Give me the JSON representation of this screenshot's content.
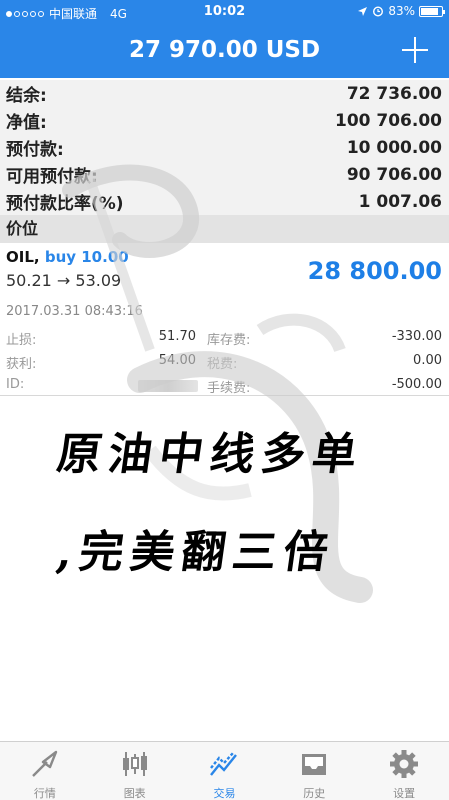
{
  "status_bar": {
    "carrier": "中国联通",
    "network": "4G",
    "time": "10:02",
    "battery": "83%",
    "battery_level": 0.83,
    "signal_bars": 1
  },
  "nav": {
    "title": "27 970.00 USD",
    "add_icon": "plus-icon"
  },
  "account": [
    {
      "label": "结余:",
      "value": "72 736.00"
    },
    {
      "label": "净值:",
      "value": "100 706.00"
    },
    {
      "label": "预付款:",
      "value": "10 000.00"
    },
    {
      "label": "可用预付款:",
      "value": "90 706.00"
    },
    {
      "label": "预付款比率(%)",
      "value": "1 007.06"
    }
  ],
  "positions_header": "价位",
  "position": {
    "symbol": "OIL,",
    "side": "buy 10.00",
    "prices": "50.21 → 53.09",
    "profit": "28 800.00",
    "open_time": "2017.03.31 08:43:16",
    "stop_loss_label": "止损:",
    "stop_loss_value": "51.70",
    "take_profit_label": "获利:",
    "take_profit_value": "54.00",
    "id_label": "ID:",
    "swap_label": "库存费:",
    "swap_value": "-330.00",
    "tax_label": "税费:",
    "tax_value": "0.00",
    "commission_label": "手续费:",
    "commission_value": "-500.00"
  },
  "overlay": {
    "line1": "原油中线多单",
    "line2": ",完美翻三倍"
  },
  "tabs": [
    {
      "label": "行情",
      "icon": "trend-arrow-icon",
      "active": false
    },
    {
      "label": "图表",
      "icon": "candlestick-icon",
      "active": false
    },
    {
      "label": "交易",
      "icon": "trade-chart-icon",
      "active": true
    },
    {
      "label": "历史",
      "icon": "inbox-icon",
      "active": false
    },
    {
      "label": "设置",
      "icon": "gear-icon",
      "active": false
    }
  ],
  "colors": {
    "brand": "#2a86e8",
    "profit": "#1e7fe6",
    "tab_inactive": "#8a8a8a"
  }
}
